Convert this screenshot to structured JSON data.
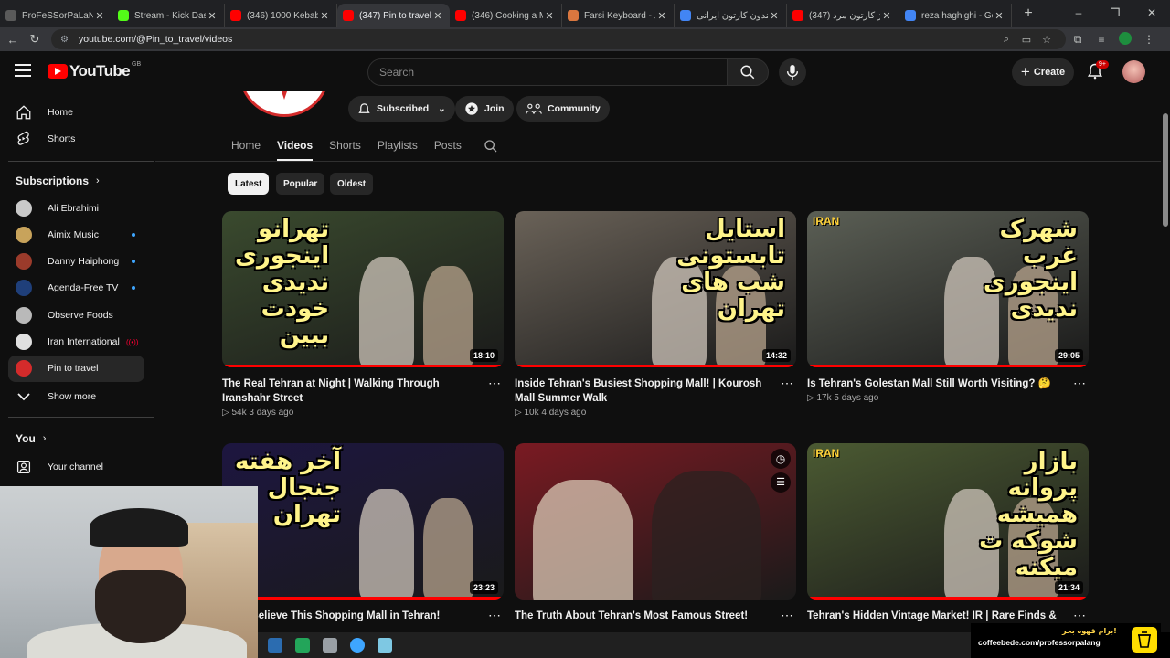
{
  "browser": {
    "tabs": [
      {
        "title": "ProFeSSorPaLaNg St",
        "color": "#5a5a5a"
      },
      {
        "title": "Stream - Kick Dashbo",
        "color": "#53fc18"
      },
      {
        "title": "(346) 1000 Kebabs a",
        "color": "#ff0000"
      },
      {
        "title": "(347) Pin to travel - Y",
        "color": "#ff0000",
        "active": true
      },
      {
        "title": "(346) Cooking a Mas",
        "color": "#ff0000"
      },
      {
        "title": "Farsi Keyboard - کلید",
        "color": "#d9773f"
      },
      {
        "title": "هلندون کارتون ایرانی -",
        "color": "#4285f4"
      },
      {
        "title": "(347) تیتراژ کارتون مرد",
        "color": "#ff0000"
      },
      {
        "title": "reza haghighi - Goog",
        "color": "#4285f4"
      }
    ],
    "new_tab_label": "+",
    "url": "youtube.com/@Pin_to_travel/videos",
    "window_controls": [
      "–",
      "❐",
      "✕"
    ]
  },
  "masthead": {
    "logo_text": "YouTube",
    "country_code": "GB",
    "search_placeholder": "Search",
    "create_label": "Create",
    "notifications_badge": "9+"
  },
  "sidebar": {
    "main": [
      {
        "label": "Home",
        "icon": "home-icon"
      },
      {
        "label": "Shorts",
        "icon": "shorts-icon"
      }
    ],
    "subscriptions_heading": "Subscriptions",
    "subscriptions": [
      {
        "label": "Ali Ebrahimi",
        "color": "#c9c9c9",
        "indicator": "none"
      },
      {
        "label": "Aimix Music",
        "color": "#c8a35b",
        "indicator": "dot"
      },
      {
        "label": "Danny Haiphong",
        "color": "#9b3b2b",
        "indicator": "dot"
      },
      {
        "label": "Agenda-Free TV",
        "color": "#1f3f7a",
        "indicator": "dot"
      },
      {
        "label": "Observe Foods",
        "color": "#b9b9b9",
        "indicator": "none"
      },
      {
        "label": "Iran International",
        "color": "#e0e0e0",
        "indicator": "live"
      },
      {
        "label": "Pin to travel",
        "color": "#d42b2b",
        "indicator": "none",
        "active": true
      }
    ],
    "show_more_label": "Show more",
    "you_heading": "You",
    "your_channel_label": "Your channel"
  },
  "channel": {
    "subscribed_label": "Subscribed",
    "join_label": "Join",
    "community_label": "Community",
    "tabs": [
      "Home",
      "Videos",
      "Shorts",
      "Playlists",
      "Posts"
    ],
    "active_tab": "Videos",
    "filters": [
      "Latest",
      "Popular",
      "Oldest"
    ],
    "active_filter": "Latest"
  },
  "videos": [
    {
      "title": "The Real Tehran at Night | Walking Through Iranshahr Street",
      "views": "54k",
      "age": "3 days ago",
      "duration": "18:10",
      "thumb_text": "تهرانو\nاینجوری\nندیدی\nخودت\nببین",
      "tag": "",
      "bg": "#3a4a2e"
    },
    {
      "title": "Inside Tehran's Busiest Shopping Mall! | Kourosh Mall Summer Walk",
      "views": "10k",
      "age": "4 days ago",
      "duration": "14:32",
      "thumb_text": "استایل\nتابستونی\nشب های\nتهران",
      "tag": "",
      "bg": "#6a6258"
    },
    {
      "title": "Is Tehran's Golestan Mall Still Worth Visiting? 🤔",
      "views": "17k",
      "age": "5 days ago",
      "duration": "29:05",
      "thumb_text": "شهرک\nغرب\nاینجوری\nندیدی",
      "tag": "IRAN",
      "bg": "#5b5f55"
    },
    {
      "title": "Can't Believe This Shopping Mall in Tehran!",
      "views": "",
      "age": "",
      "duration": "23:23",
      "thumb_text": "آخر هفته\nجنجال\nتهران",
      "tag": "",
      "bg": "#1d1640"
    },
    {
      "title": "The Truth About Tehran's Most Famous Street!",
      "views": "",
      "age": "",
      "duration": "",
      "thumb_text": "",
      "tag": "",
      "bg": "#7a1a22"
    },
    {
      "title": "Tehran's Hidden Vintage Market! IR | Rare Finds &",
      "views": "",
      "age": "",
      "duration": "21:34",
      "thumb_text": "بازار\nپروانه\nهمیشه\nشوکه ت\nمیکنه",
      "tag": "IRAN",
      "bg": "#4b5a32"
    }
  ],
  "overlay": {
    "coffee_fa": "برام قهوه بخر!",
    "coffee_url": "coffeebede.com/professorpalang"
  }
}
